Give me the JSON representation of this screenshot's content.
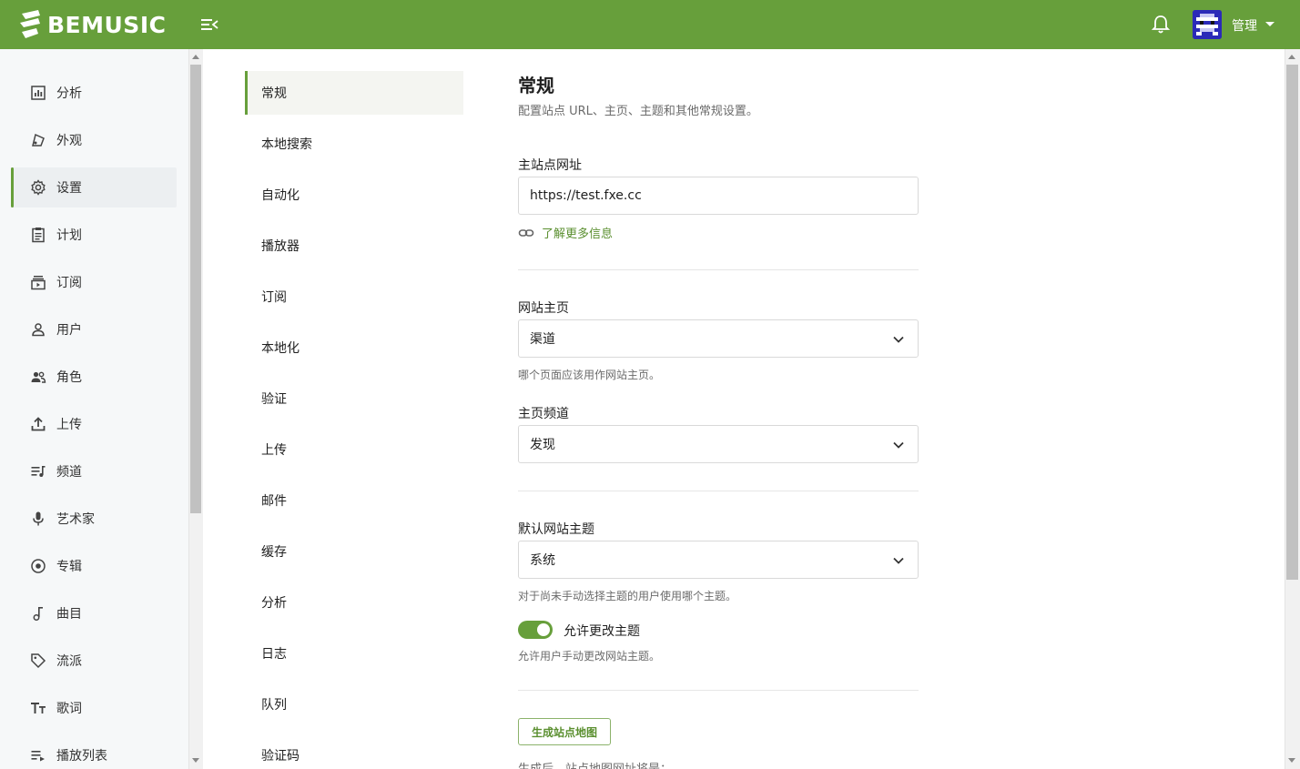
{
  "header": {
    "brand": "BEMUSIC",
    "brand_color": "#679f3b",
    "user_label": "管理",
    "icons": [
      "menu-collapse-icon",
      "bell-icon",
      "caret-down-icon"
    ]
  },
  "sidebar": {
    "items": [
      {
        "label": "分析",
        "icon": "analytics-icon"
      },
      {
        "label": "外观",
        "icon": "appearance-icon"
      },
      {
        "label": "设置",
        "icon": "gear-icon",
        "active": true
      },
      {
        "label": "计划",
        "icon": "plan-icon"
      },
      {
        "label": "订阅",
        "icon": "subscription-icon"
      },
      {
        "label": "用户",
        "icon": "user-icon"
      },
      {
        "label": "角色",
        "icon": "roles-icon"
      },
      {
        "label": "上传",
        "icon": "upload-icon"
      },
      {
        "label": "频道",
        "icon": "channel-icon"
      },
      {
        "label": "艺术家",
        "icon": "microphone-icon"
      },
      {
        "label": "专辑",
        "icon": "album-icon"
      },
      {
        "label": "曲目",
        "icon": "music-note-icon"
      },
      {
        "label": "流派",
        "icon": "tag-icon"
      },
      {
        "label": "歌词",
        "icon": "text-icon"
      },
      {
        "label": "播放列表",
        "icon": "playlist-icon"
      }
    ]
  },
  "settings_nav": {
    "items": [
      "常规",
      "本地搜索",
      "自动化",
      "播放器",
      "订阅",
      "本地化",
      "验证",
      "上传",
      "邮件",
      "缓存",
      "分析",
      "日志",
      "队列",
      "验证码"
    ]
  },
  "main": {
    "title": "常规",
    "subtitle": "配置站点 URL、主页、主题和其他常规设置。",
    "site_url": {
      "label": "主站点网址",
      "value": "https://test.fxe.cc",
      "link_label": "了解更多信息"
    },
    "homepage": {
      "label": "网站主页",
      "value": "渠道",
      "help": "哪个页面应该用作网站主页。"
    },
    "homepage_channel": {
      "label": "主页频道",
      "value": "发现"
    },
    "theme": {
      "label": "默认网站主题",
      "value": "系统",
      "help": "对于尚未手动选择主题的用户使用哪个主题。"
    },
    "allow_theme_change": {
      "label": "允许更改主题",
      "help": "允许用户手动更改网站主题。",
      "enabled": true
    },
    "sitemap": {
      "button_label": "生成站点地图",
      "cutoff_text": "生成后，站点地图网址将是："
    }
  }
}
